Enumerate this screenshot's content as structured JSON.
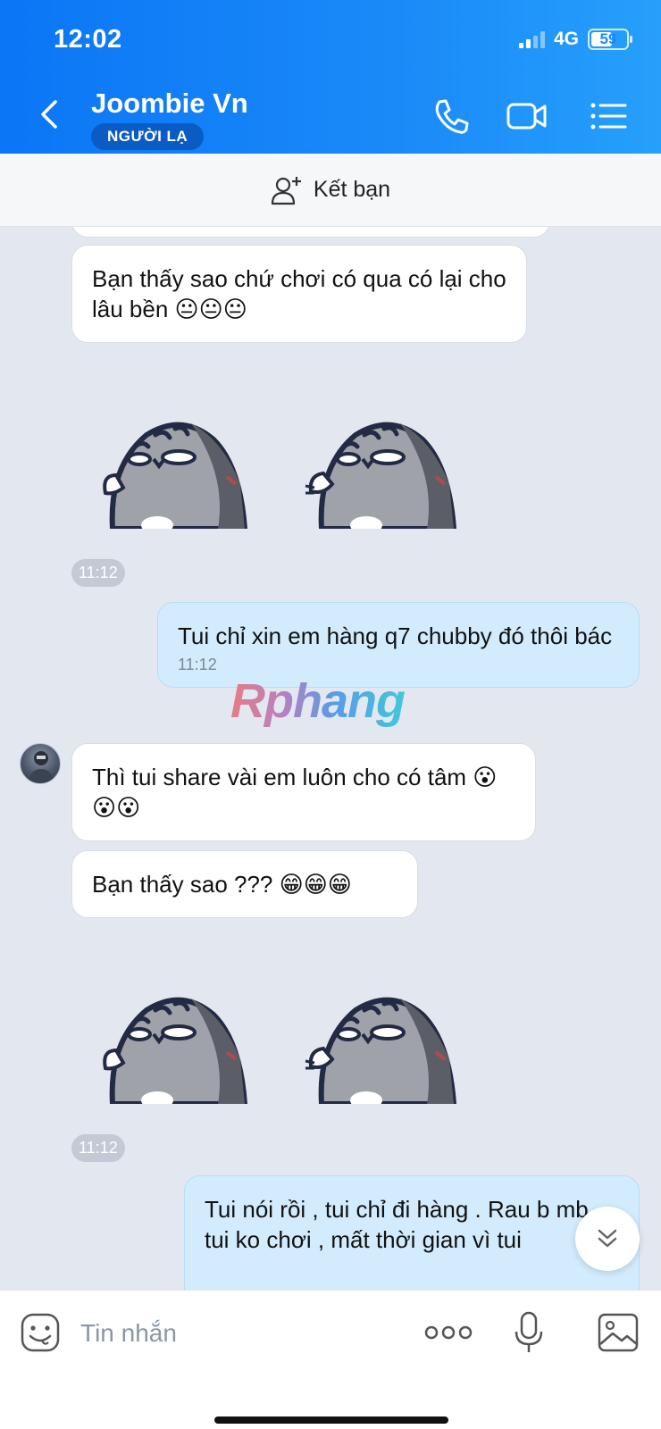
{
  "status_bar": {
    "time": "12:02",
    "network": "4G",
    "battery": "59"
  },
  "header": {
    "contact_name": "Joombie Vn",
    "badge": "NGƯỜI LẠ"
  },
  "add_friend": {
    "label": "Kết bạn"
  },
  "messages": {
    "m1": "Bạn thấy sao chứ chơi có qua có lại cho lâu bền 😐😐😐",
    "t1": "11:12",
    "m2": "Tui chỉ xin em hàng q7 chubby đó thôi bác",
    "m2_time": "11:12",
    "m3": "Thì tui share vài em luôn cho có tâm 😮😮😮",
    "m4": "Bạn thấy sao ??? 😁😁😁",
    "t2": "11:12",
    "m5": "Tui nói rồi , tui chỉ đi hàng . Rau b mb tui ko chơi , mất thời gian vì tui"
  },
  "watermark": "Rphang",
  "input": {
    "placeholder": "Tin nhắn"
  },
  "colors": {
    "header": "#1a8af8",
    "outgoing_bubble": "#d2ecfd",
    "incoming_bubble": "#ffffff",
    "chat_bg": "#e3e8f0"
  }
}
